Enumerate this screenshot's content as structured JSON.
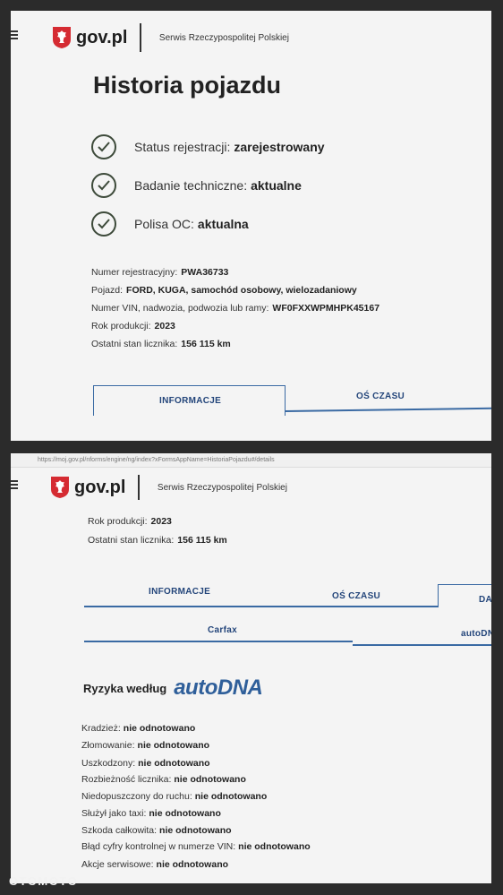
{
  "panel1": {
    "logo": "gov.pl",
    "serwis": "Serwis Rzeczypospolitej Polskiej",
    "title": "Historia pojazdu",
    "statuses": [
      {
        "label": "Status rejestracji:",
        "value": "zarejestrowany"
      },
      {
        "label": "Badanie techniczne:",
        "value": "aktualne"
      },
      {
        "label": "Polisa OC:",
        "value": "aktualna"
      }
    ],
    "details": [
      {
        "label": "Numer rejestracyjny:",
        "value": "PWA36733"
      },
      {
        "label": "Pojazd:",
        "value": "FORD, KUGA, samochód osobowy, wielozadaniowy"
      },
      {
        "label": "Numer VIN, nadwozia, podwozia lub ramy:",
        "value": "WF0FXXWPMHPK45167"
      },
      {
        "label": "Rok produkcji:",
        "value": "2023"
      },
      {
        "label": "Ostatni stan licznika:",
        "value": "156 115 km"
      }
    ],
    "tabs": {
      "info": "INFORMACJE",
      "timeline": "OŚ CZASU"
    }
  },
  "panel2": {
    "url": "https://moj.gov.pl/nforms/engine/ng/index?xFormsAppName=HistoriaPojazdu#/details",
    "logo": "gov.pl",
    "serwis": "Serwis Rzeczypospolitej Polskiej",
    "details": [
      {
        "label": "Rok produkcji:",
        "value": "2023"
      },
      {
        "label": "Ostatni stan licznika:",
        "value": "156 115 km"
      }
    ],
    "tabs": {
      "info": "INFORMACJE",
      "timeline": "OŚ CZASU",
      "data": "DA"
    },
    "subtabs": {
      "carfax": "Carfax",
      "autodna": "autoDN"
    },
    "risk_title": "Ryzyka według",
    "risk_brand": "autoDNA",
    "risks": [
      {
        "label": "Kradzież:",
        "value": "nie odnotowano"
      },
      {
        "label": "Złomowanie:",
        "value": "nie odnotowano"
      },
      {
        "label": "Uszkodzony:",
        "value": "nie odnotowano"
      },
      {
        "label": "Rozbieżność licznika:",
        "value": "nie odnotowano"
      },
      {
        "label": "Niedopuszczony do ruchu:",
        "value": "nie odnotowano"
      },
      {
        "label": "Służył jako taxi:",
        "value": "nie odnotowano"
      },
      {
        "label": "Szkoda całkowita:",
        "value": "nie odnotowano"
      },
      {
        "label": "Błąd cyfry kontrolnej w numerze VIN:",
        "value": "nie odnotowano"
      },
      {
        "label": "Akcje serwisowe:",
        "value": "nie odnotowano"
      }
    ]
  },
  "watermark": "OTOMOTO",
  "colors": {
    "accent": "#3a6aa3",
    "tab_text": "#23457a",
    "brand": "#2f5f9a",
    "check": "#3d4a3a"
  }
}
